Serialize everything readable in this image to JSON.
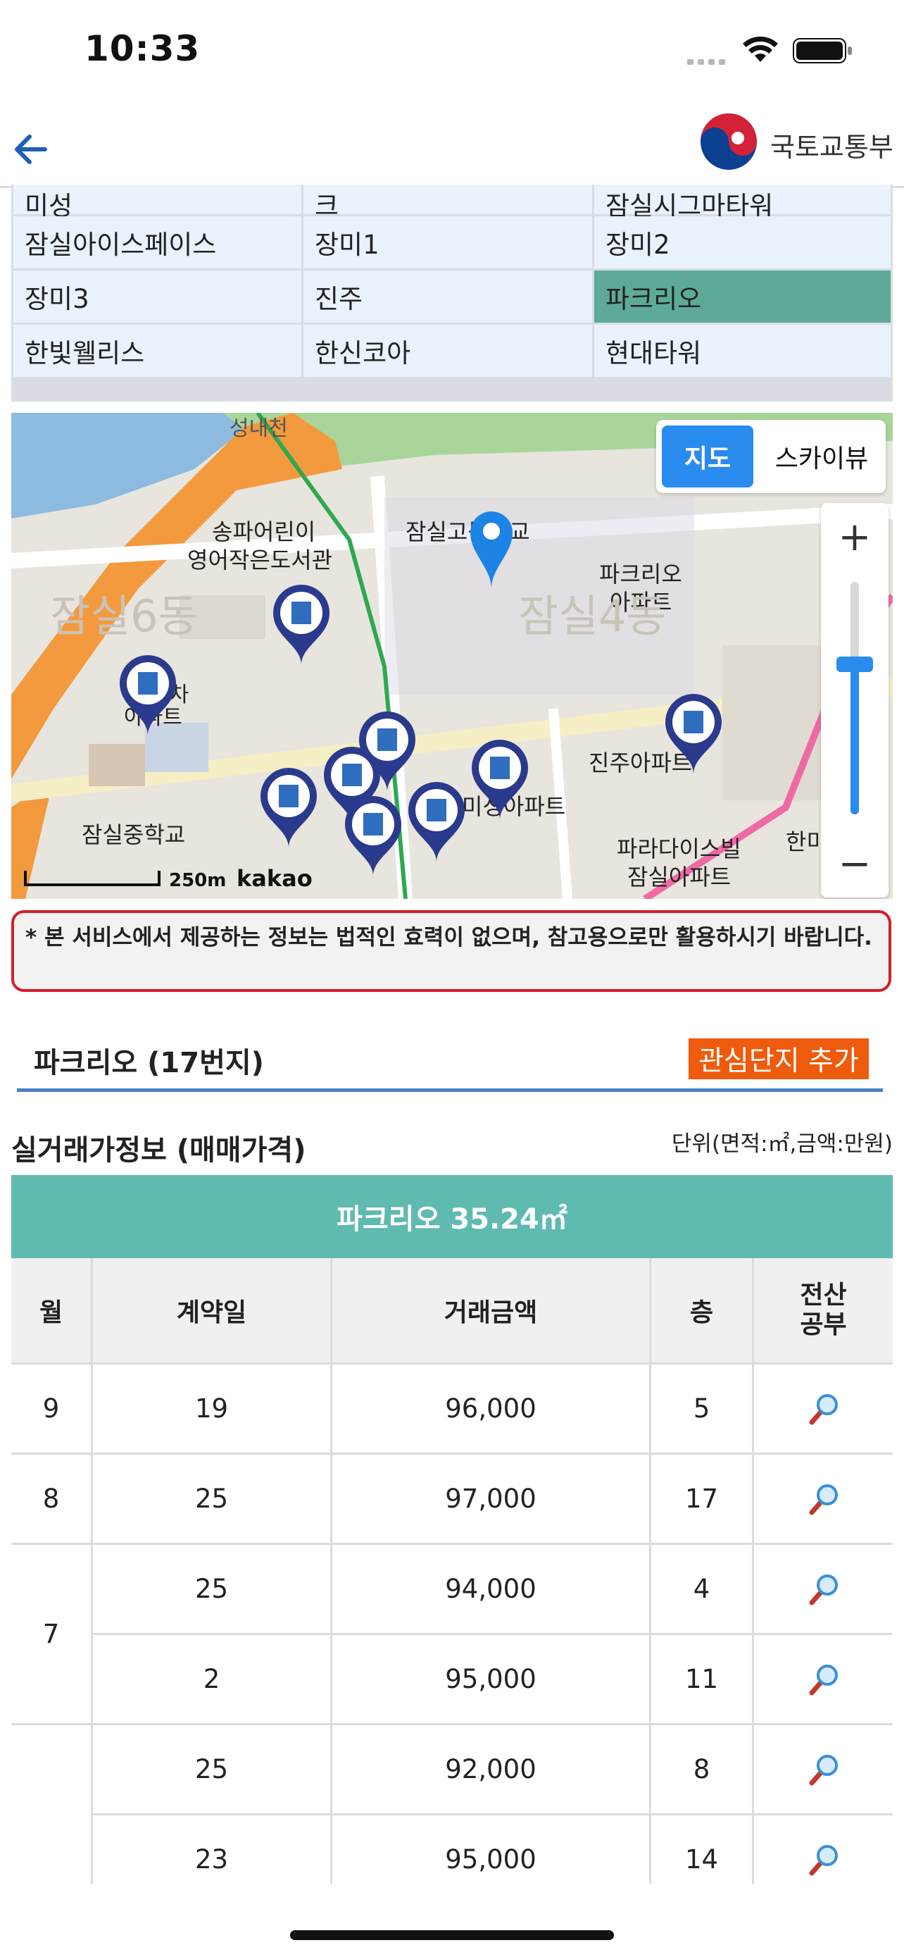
{
  "status_bar": {
    "time": "10:33"
  },
  "header": {
    "logo_text": "국토교통부"
  },
  "apartment_grid": {
    "partial_row": [
      "미성",
      "크",
      "잠실시그마타워"
    ],
    "rows": [
      [
        "잠실아이스페이스",
        "장미1",
        "장미2"
      ],
      [
        "장미3",
        "진주",
        "파크리오"
      ],
      [
        "한빛웰리스",
        "한신코아",
        "현대타워"
      ]
    ],
    "selected": "파크리오"
  },
  "map": {
    "toggle_map": "지도",
    "toggle_sky": "스카이뷰",
    "zoom_in": "+",
    "zoom_out": "−",
    "scale": "250m",
    "provider": "kakao",
    "labels": {
      "stream": "성내천",
      "library": "송파어린이\n영어작은도서관",
      "highschool": "잠실고등학교",
      "parkrio": "파크리오\n아파트",
      "dong6": "잠실6동",
      "dong4": "잠실4동",
      "apt_left": "잠실 차\n아파트",
      "jinju": "진주아파트",
      "misung": "미성아파트",
      "middleschool": "잠실중학교",
      "paradise": "파라다이스빌\n잠실아파트",
      "han": "한미"
    }
  },
  "notice": "* 본 서비스에서 제공하는 정보는 법적인 효력이 없으며, 참고용으로만 활용하시기 바랍니다.",
  "complex": {
    "title": "파크리오 (17번지)",
    "favorite_button": "관심단지 추가"
  },
  "section": {
    "title": "실거래가정보 (매매가격)",
    "unit": "단위(면적:㎡,금액:만원)"
  },
  "table": {
    "title": "파크리오 35.24㎡",
    "headers": [
      "월",
      "계약일",
      "거래금액",
      "층",
      "전산\n공부"
    ],
    "rows": [
      {
        "month": "9",
        "day": "19",
        "price": "96,000",
        "floor": "5"
      },
      {
        "month": "8",
        "day": "25",
        "price": "97,000",
        "floor": "17"
      },
      {
        "month": "7",
        "day": "25",
        "price": "94,000",
        "floor": "4"
      },
      {
        "month": "",
        "day": "2",
        "price": "95,000",
        "floor": "11"
      },
      {
        "month": "",
        "day": "25",
        "price": "92,000",
        "floor": "8"
      },
      {
        "month": "",
        "day": "23",
        "price": "95,000",
        "floor": "14"
      }
    ]
  },
  "colors": {
    "accent_blue": "#2a6bdc",
    "selected_cell": "#5daa98",
    "table_title": "#5fbab0",
    "favorite": "#ef5b0c",
    "notice_border": "#d0202a"
  }
}
